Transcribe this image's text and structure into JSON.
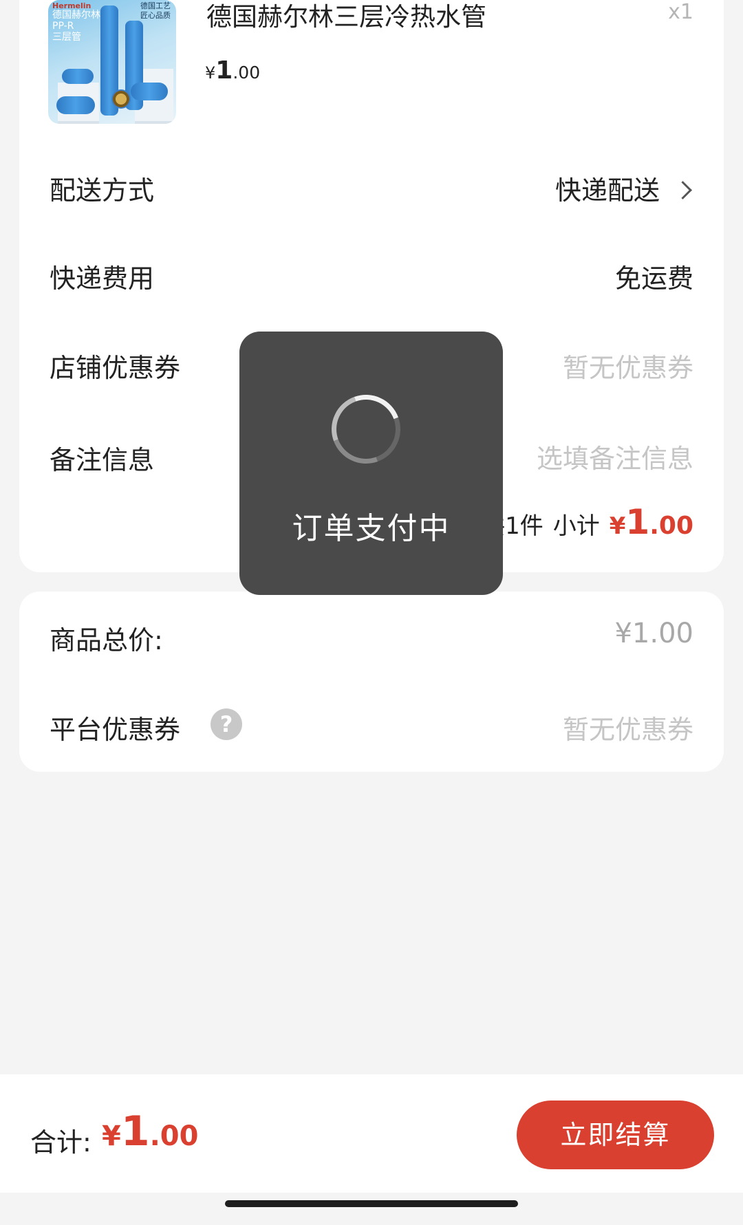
{
  "product": {
    "thumb_brand": "Hermelin",
    "thumb_line1": "德国赫尔林",
    "thumb_line2": "PP-R",
    "thumb_line3": "三层管",
    "thumb_slogan1": "德国工艺",
    "thumb_slogan2": "匠心品质",
    "title": "德国赫尔林三层冷热水管",
    "quantity": "x1",
    "price_currency": "¥",
    "price_int": "1",
    "price_dec": ".00"
  },
  "rows": {
    "delivery_label": "配送方式",
    "delivery_value": "快递配送",
    "shipping_label": "快递费用",
    "shipping_value": "免运费",
    "store_coupon_label": "店铺优惠券",
    "store_coupon_value": "暂无优惠券",
    "remark_label": "备注信息",
    "remark_placeholder": "选填备注信息"
  },
  "subtotal": {
    "count_text": "共1件",
    "label": "小计",
    "currency": "¥",
    "int": "1",
    "dec": ".00"
  },
  "summary": {
    "goods_total_label": "商品总价:",
    "goods_total_value": "¥1.00",
    "platform_coupon_label": "平台优惠券",
    "platform_coupon_value": "暂无优惠券",
    "help_glyph": "?"
  },
  "toast": {
    "text": "订单支付中"
  },
  "bottom_bar": {
    "total_label": "合计:",
    "currency": "¥",
    "int": "1",
    "dec": ".00",
    "checkout_label": "立即结算"
  },
  "colors": {
    "accent": "#d9402f",
    "background": "#f4f4f4",
    "muted_text": "#c5c5c5",
    "toast_bg": "#4a4a4a"
  },
  "icons": {
    "chevron": "chevron-right-icon",
    "help": "question-circle-icon",
    "spinner": "loading-spinner-icon"
  }
}
